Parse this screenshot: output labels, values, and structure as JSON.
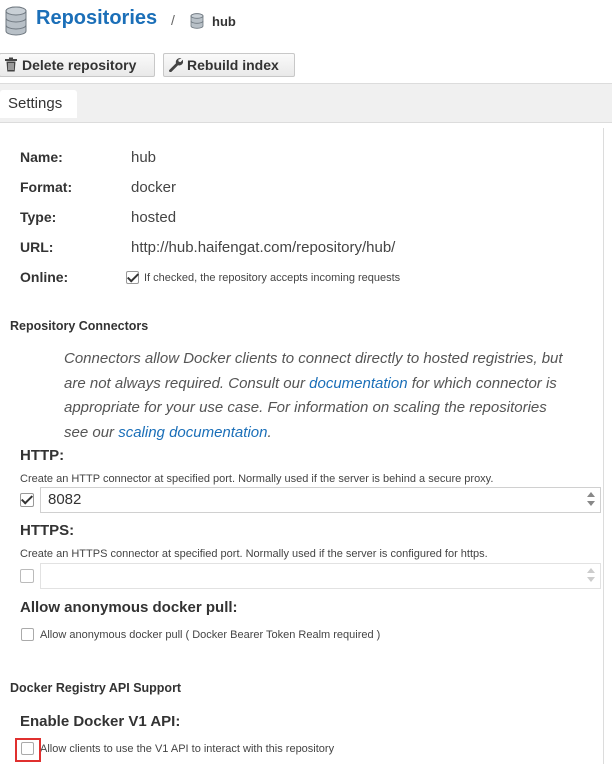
{
  "breadcrumb": {
    "title": "Repositories",
    "separator": "/",
    "current": "hub"
  },
  "toolbar": {
    "delete_label": "Delete repository",
    "rebuild_label": "Rebuild index"
  },
  "tabs": [
    {
      "label": "Settings",
      "active": true
    }
  ],
  "settings": {
    "name_label": "Name:",
    "name_value": "hub",
    "format_label": "Format:",
    "format_value": "docker",
    "type_label": "Type:",
    "type_value": "hosted",
    "url_label": "URL:",
    "url_value": "http://hub.haifengat.com/repository/hub/",
    "online_label": "Online:",
    "online_checked": true,
    "online_help": "If checked, the repository accepts incoming requests"
  },
  "connectors": {
    "section_title": "Repository Connectors",
    "help_part1": "Connectors allow Docker clients to connect directly to hosted registries, but are not always required. Consult our ",
    "help_link1": "documentation",
    "help_part2": " for which connector is appropriate for your use case. For information on scaling the repositories see our ",
    "help_link2": "scaling documentation",
    "help_part3": ".",
    "http_label": "HTTP:",
    "http_help": "Create an HTTP connector at specified port. Normally used if the server is behind a secure proxy.",
    "http_checked": true,
    "http_port": "8082",
    "https_label": "HTTPS:",
    "https_help": "Create an HTTPS connector at specified port. Normally used if the server is configured for https.",
    "https_checked": false,
    "https_port": "",
    "anon_label": "Allow anonymous docker pull:",
    "anon_checked": false,
    "anon_help": "Allow anonymous docker pull ( Docker Bearer Token Realm required )"
  },
  "api_support": {
    "section_title": "Docker Registry API Support",
    "v1_label": "Enable Docker V1 API:",
    "v1_checked": false,
    "v1_help": "Allow clients to use the V1 API to interact with this repository"
  },
  "colors": {
    "link": "#1b6fb8",
    "highlight": "#e0302f"
  },
  "icons": {
    "repositories": "database-icon",
    "hub": "database-icon",
    "delete": "trash-icon",
    "rebuild": "wrench-icon"
  }
}
